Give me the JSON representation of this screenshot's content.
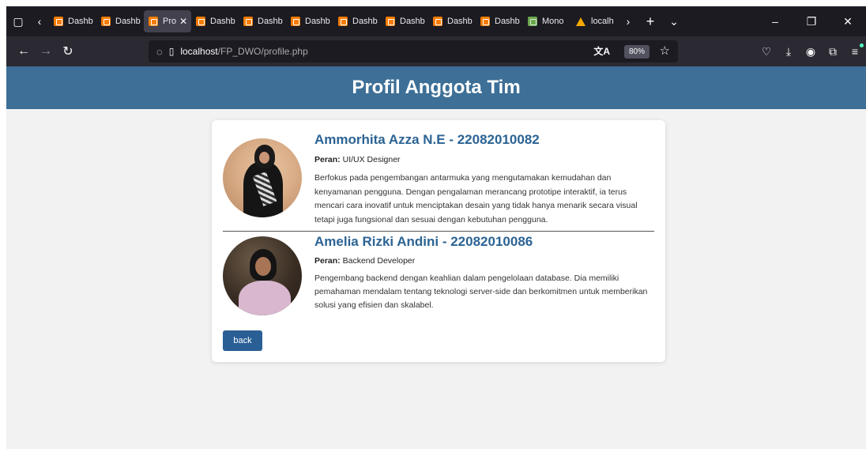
{
  "browser": {
    "tabs": [
      {
        "label": "Dashb",
        "icon": "xampp-icon"
      },
      {
        "label": "Dashb",
        "icon": "xampp-icon"
      },
      {
        "label": "Pro",
        "icon": "xampp-icon",
        "active": true
      },
      {
        "label": "Dashb",
        "icon": "xampp-icon"
      },
      {
        "label": "Dashb",
        "icon": "xampp-icon"
      },
      {
        "label": "Dashb",
        "icon": "xampp-icon"
      },
      {
        "label": "Dashb",
        "icon": "xampp-icon"
      },
      {
        "label": "Dashb",
        "icon": "xampp-icon"
      },
      {
        "label": "Dashb",
        "icon": "xampp-icon"
      },
      {
        "label": "Dashb",
        "icon": "xampp-icon"
      },
      {
        "label": "Mono",
        "icon": "map-icon"
      },
      {
        "label": "localh",
        "icon": "localhost-icon"
      }
    ],
    "url_host": "localhost",
    "url_path": "/FP_DWO/profile.php",
    "zoom": "80%"
  },
  "page": {
    "title": "Profil Anggota Tim",
    "members": [
      {
        "name": "Ammorhita Azza N.E - 22082010082",
        "role_label": "Peran:",
        "role": "UI/UX Designer",
        "description": "Berfokus pada pengembangan antarmuka yang mengutamakan kemudahan dan kenyamanan pengguna. Dengan pengalaman merancang prototipe interaktif, ia terus mencari cara inovatif untuk menciptakan desain yang tidak hanya menarik secara visual tetapi juga fungsional dan sesuai dengan kebutuhan pengguna."
      },
      {
        "name": "Amelia Rizki Andini - 22082010086",
        "role_label": "Peran:",
        "role": "Backend Developer",
        "description": "Pengembang backend dengan keahlian dalam pengelolaan database. Dia memiliki pemahaman mendalam tentang teknologi server-side dan berkomitmen untuk memberikan solusi yang efisien dan skalabel."
      }
    ],
    "back_label": "back"
  },
  "colors": {
    "header": "#3d6f97",
    "name": "#2b6393",
    "button": "#2a5f95"
  }
}
